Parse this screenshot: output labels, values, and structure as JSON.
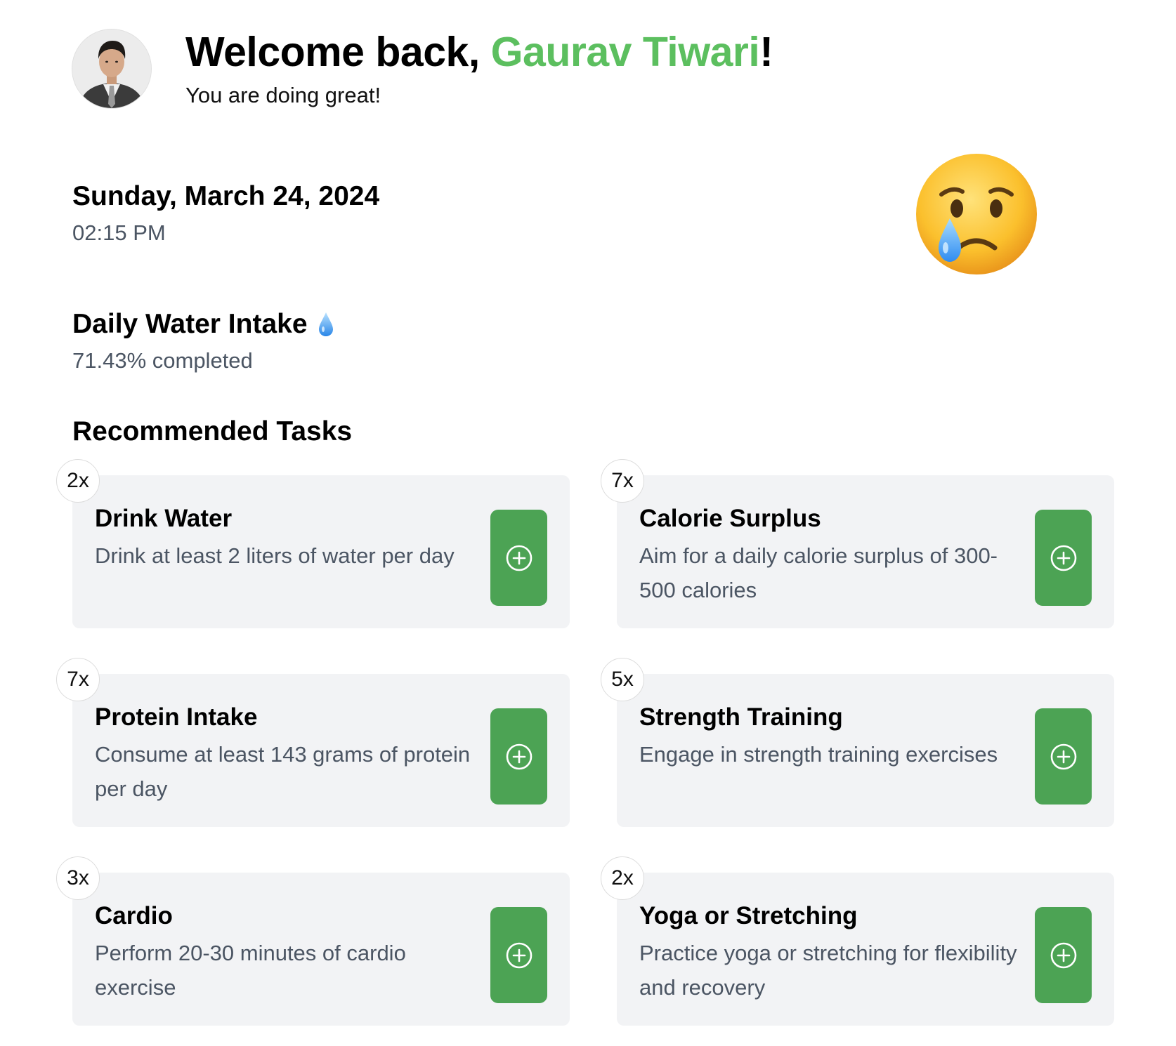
{
  "header": {
    "welcome_prefix": "Welcome back, ",
    "user_name": "Gaurav Tiwari",
    "welcome_suffix": "!",
    "subtitle": "You are doing great!"
  },
  "datetime": {
    "date": "Sunday, March 24, 2024",
    "time": "02:15 PM"
  },
  "mood": {
    "icon": "crying-face-icon"
  },
  "water": {
    "title": "Daily Water Intake",
    "icon": "water-drop-icon",
    "progress_text": "71.43% completed"
  },
  "tasks": {
    "title": "Recommended Tasks",
    "items": [
      {
        "count": "2x",
        "title": "Drink Water",
        "description": "Drink at least 2 liters of water per day"
      },
      {
        "count": "7x",
        "title": "Calorie Surplus",
        "description": "Aim for a daily calorie surplus of 300-500 calories"
      },
      {
        "count": "7x",
        "title": "Protein Intake",
        "description": "Consume at least 143 grams of protein per day"
      },
      {
        "count": "5x",
        "title": "Strength Training",
        "description": "Engage in strength training exercises"
      },
      {
        "count": "3x",
        "title": "Cardio",
        "description": "Perform 20-30 minutes of cardio exercise"
      },
      {
        "count": "2x",
        "title": "Yoga or Stretching",
        "description": "Practice yoga or stretching for flexibility and recovery"
      }
    ]
  },
  "colors": {
    "accent_green": "#5cbf5f",
    "button_green": "#4ca354",
    "card_background": "#f2f3f5",
    "muted_text": "#4b5563"
  }
}
